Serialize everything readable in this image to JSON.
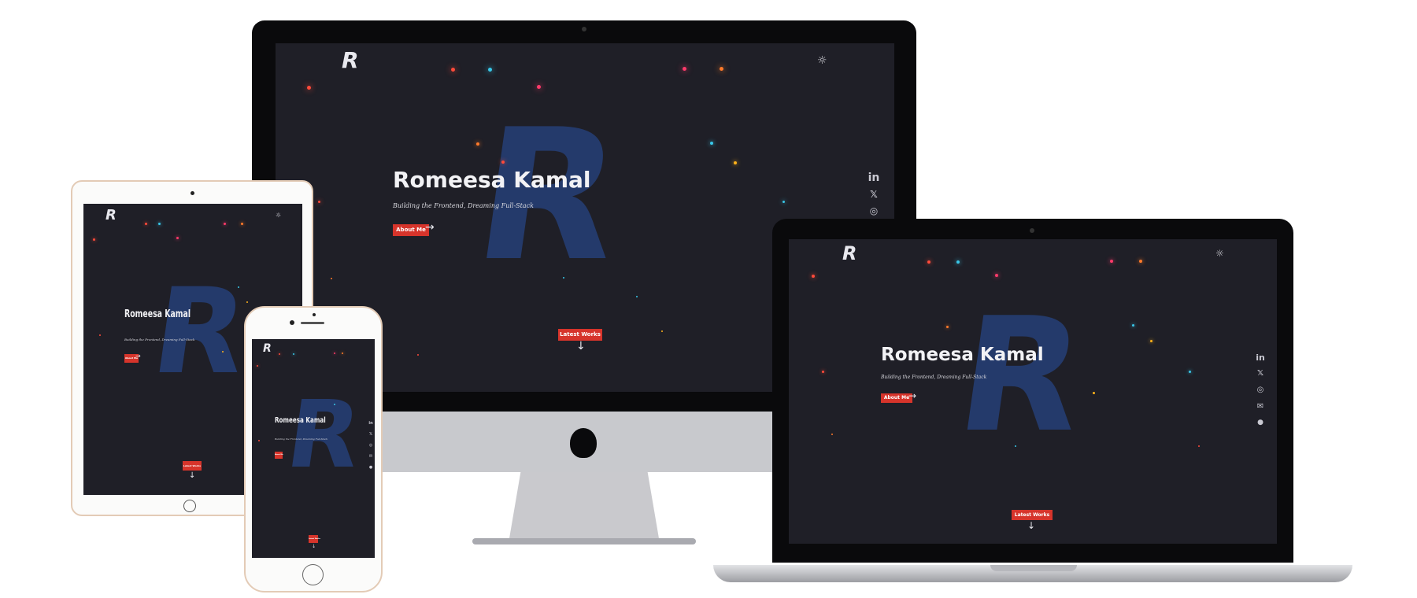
{
  "site": {
    "logo": "R",
    "name": "Romeesa Kamal",
    "tagline": "Building the Frontend, Dreaming Full-Stack",
    "about_button": "About Me",
    "latest_works_button": "Latest Works",
    "theme_toggle_icon": "sun-icon",
    "down_arrow": "↓",
    "right_arrow": "→",
    "social": [
      {
        "icon": "linkedin-icon",
        "glyph": "in"
      },
      {
        "icon": "x-icon",
        "glyph": "𝕏"
      },
      {
        "icon": "instagram-icon",
        "glyph": "◎"
      },
      {
        "icon": "mail-icon",
        "glyph": "✉"
      },
      {
        "icon": "github-icon",
        "glyph": "●"
      }
    ]
  },
  "colors": {
    "screen_bg": "#1f1f27",
    "accent_red": "#d6342b",
    "monogram_blue": "#243a6b"
  },
  "devices": [
    "desktop-imac",
    "laptop-macbook",
    "tablet-ipad",
    "phone-iphone"
  ]
}
